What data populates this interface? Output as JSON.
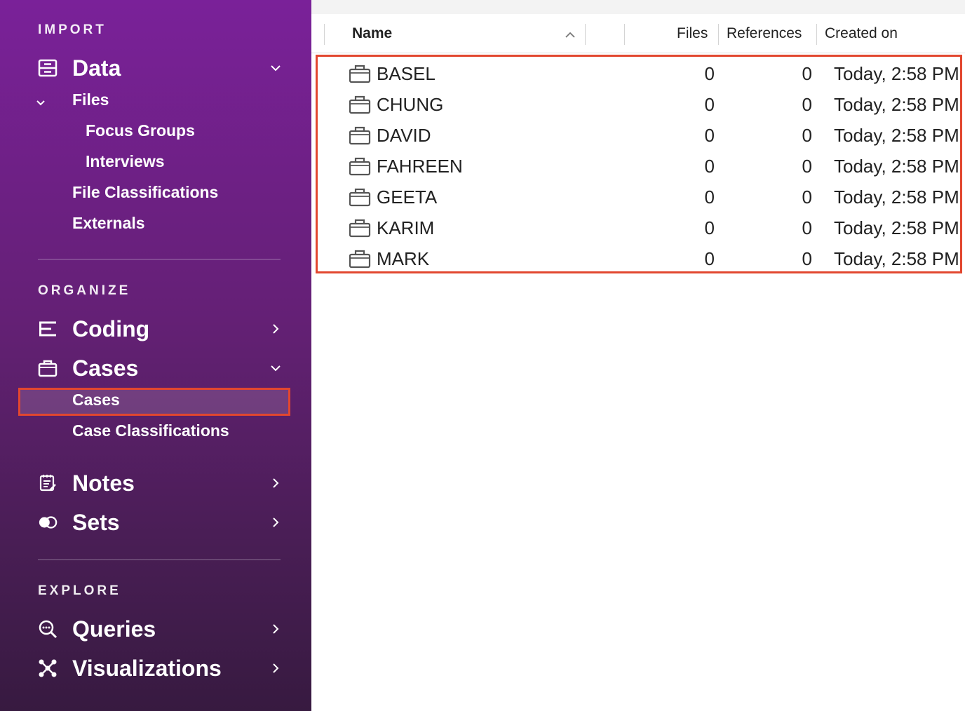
{
  "sidebar": {
    "sections": {
      "import": "IMPORT",
      "organize": "ORGANIZE",
      "explore": "EXPLORE"
    },
    "data": {
      "label": "Data",
      "icon": "data-icon",
      "expanded": true
    },
    "files": {
      "label": "Files",
      "expanded": true
    },
    "focus_groups": "Focus Groups",
    "interviews": "Interviews",
    "file_classifications": "File Classifications",
    "externals": "Externals",
    "coding": {
      "label": "Coding",
      "icon": "coding-icon"
    },
    "cases": {
      "label": "Cases",
      "icon": "briefcase-icon",
      "expanded": true
    },
    "cases_sub": {
      "label": "Cases",
      "selected": true
    },
    "case_classifications": "Case Classifications",
    "notes": {
      "label": "Notes",
      "icon": "notes-icon"
    },
    "sets": {
      "label": "Sets",
      "icon": "sets-icon"
    },
    "queries": {
      "label": "Queries",
      "icon": "queries-icon"
    },
    "visualizations": {
      "label": "Visualizations",
      "icon": "visualizations-icon"
    }
  },
  "table": {
    "columns": {
      "name": "Name",
      "files": "Files",
      "references": "References",
      "created_on": "Created on"
    },
    "sort": "name-ascending",
    "rows": [
      {
        "name": "BASEL",
        "files": "0",
        "references": "0",
        "created": "Today, 2:58 PM"
      },
      {
        "name": "CHUNG",
        "files": "0",
        "references": "0",
        "created": "Today, 2:58 PM"
      },
      {
        "name": "DAVID",
        "files": "0",
        "references": "0",
        "created": "Today, 2:58 PM"
      },
      {
        "name": "FAHREEN",
        "files": "0",
        "references": "0",
        "created": "Today, 2:58 PM"
      },
      {
        "name": "GEETA",
        "files": "0",
        "references": "0",
        "created": "Today, 2:58 PM"
      },
      {
        "name": "KARIM",
        "files": "0",
        "references": "0",
        "created": "Today, 2:58 PM"
      },
      {
        "name": "MARK",
        "files": "0",
        "references": "0",
        "created": "Today, 2:58 PM"
      }
    ]
  },
  "colors": {
    "sidebar_top": "#7a2199",
    "sidebar_bottom": "#371a40",
    "highlight": "#e2472f"
  }
}
